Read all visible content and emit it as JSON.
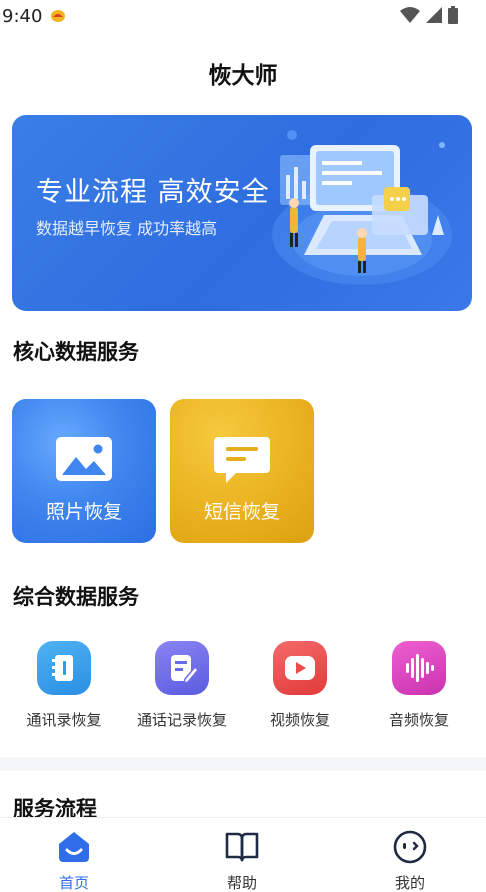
{
  "status_bar": {
    "time": "9:40"
  },
  "header": {
    "title": "恢大师"
  },
  "banner": {
    "headline": "专业流程 高效安全",
    "subline": "数据越早恢复 成功率越高"
  },
  "core_section": {
    "title": "核心数据服务",
    "cards": [
      {
        "label": "照片恢复",
        "icon": "image-icon",
        "color": "#3f86ee"
      },
      {
        "label": "短信恢复",
        "icon": "message-icon",
        "color": "#e6ad1c"
      }
    ]
  },
  "general_section": {
    "title": "综合数据服务",
    "items": [
      {
        "label": "通讯录恢复",
        "icon": "contacts-icon",
        "color": "#2f9be8"
      },
      {
        "label": "通话记录恢复",
        "icon": "call-log-icon",
        "color": "#6b6be8"
      },
      {
        "label": "视频恢复",
        "icon": "video-icon",
        "color": "#ee4a4a"
      },
      {
        "label": "音频恢复",
        "icon": "audio-icon",
        "color": "#d83fbd"
      }
    ]
  },
  "flow_section": {
    "title": "服务流程"
  },
  "bottom_nav": {
    "items": [
      {
        "label": "首页",
        "icon": "home-icon",
        "active": true
      },
      {
        "label": "帮助",
        "icon": "book-icon",
        "active": false
      },
      {
        "label": "我的",
        "icon": "profile-icon",
        "active": false
      }
    ]
  },
  "colors": {
    "accent": "#2f6ee8",
    "banner": "#3274e4"
  }
}
